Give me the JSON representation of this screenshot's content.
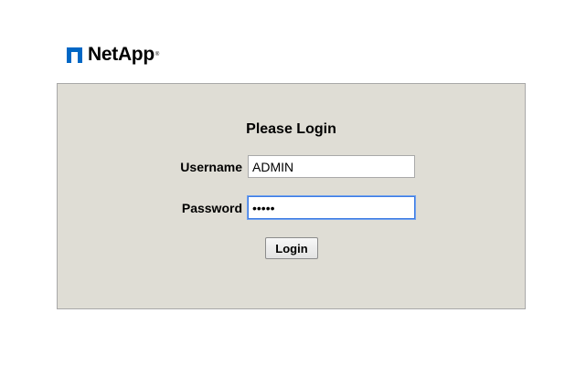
{
  "brand": {
    "name": "NetApp",
    "trademark": "®",
    "logo_icon": "netapp-n-logo-icon",
    "logo_color": "#0067c5"
  },
  "login": {
    "title": "Please Login",
    "username_label": "Username",
    "username_value": "ADMIN",
    "password_label": "Password",
    "password_value": "•••••",
    "submit_label": "Login",
    "panel_color": "#dfddd5"
  }
}
